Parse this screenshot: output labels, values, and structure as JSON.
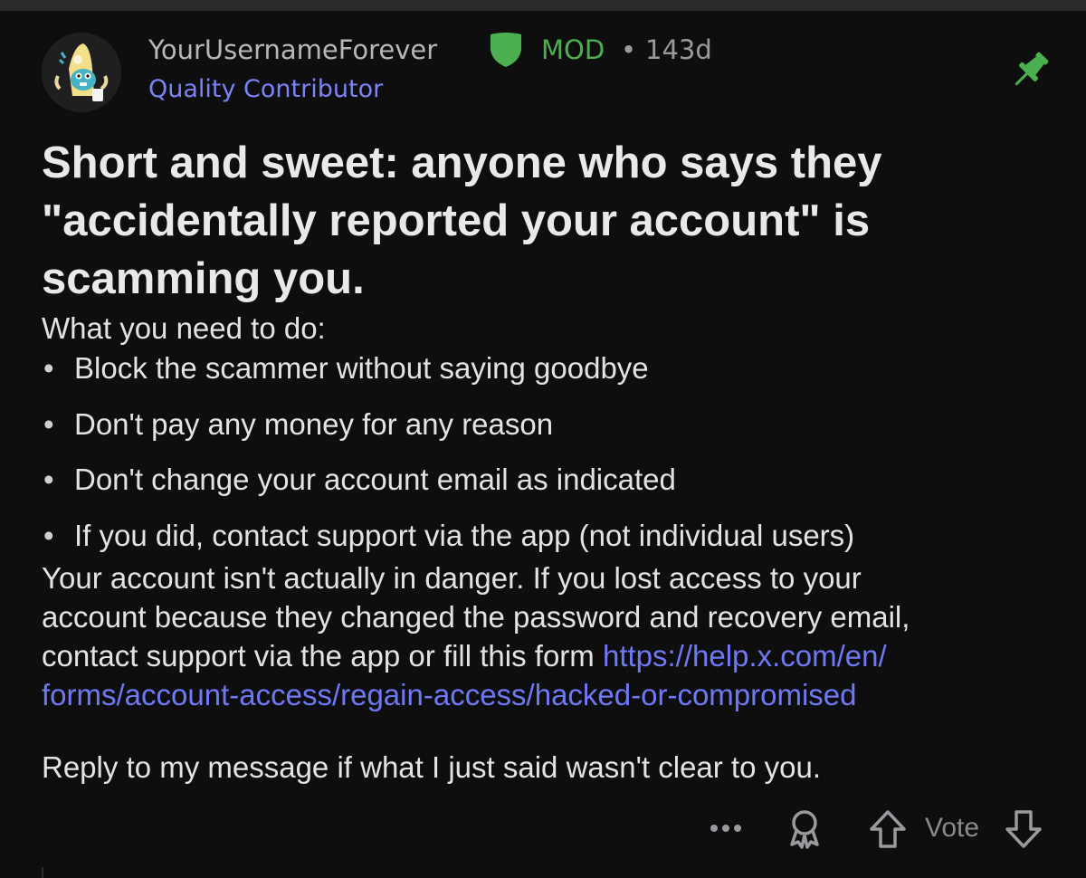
{
  "post": {
    "username": "YourUsernameForever",
    "mod_label": "MOD",
    "separator": "•",
    "age": "143d",
    "flair": "Quality Contributor",
    "title": "Short and sweet: anyone who says they \"accidentally reported your account\" is scamming you.",
    "intro": "What you need to do:",
    "bullets": [
      "Block the scammer without saying goodbye",
      "Don't pay any money for any reason",
      "Don't change your account email as indicated",
      "If you did, contact support via the app (not individual users)"
    ],
    "bullet_marker": "•",
    "paragraph": {
      "line1": "Your account isn't actually in danger. If you lost access to your",
      "line2": "account because they changed the password and recovery email,",
      "line3_text": "contact support via the app or fill this form ",
      "line3_link": "https://help.x.com/en/",
      "line4_link": "forms/account-access/regain-access/hacked-or-compromised"
    },
    "reply_note": "Reply to my message if what I just said wasn't clear to you."
  },
  "actions": {
    "vote_label": "Vote"
  },
  "icons": {
    "mod": "shield-icon",
    "pin": "pin-icon",
    "more": "more-icon",
    "award": "award-icon",
    "upvote": "upvote-arrow-icon",
    "downvote": "downvote-arrow-icon"
  },
  "colors": {
    "background": "#0e0e0f",
    "mod_green": "#4caf50",
    "flair_blue": "#7b83f7",
    "link_blue": "#6f78f5",
    "pin_green": "#4caf50"
  }
}
